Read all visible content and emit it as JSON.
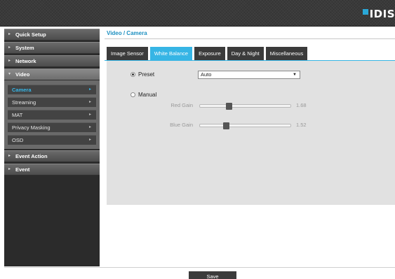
{
  "header": {
    "logo_text": "IDIS"
  },
  "sidebar": {
    "items": [
      {
        "label": "Quick Setup"
      },
      {
        "label": "System"
      },
      {
        "label": "Network"
      },
      {
        "label": "Video"
      },
      {
        "label": "Event Action"
      },
      {
        "label": "Event"
      }
    ],
    "video_submenu": [
      {
        "label": "Camera"
      },
      {
        "label": "Streaming"
      },
      {
        "label": "MAT"
      },
      {
        "label": "Privacy Masking"
      },
      {
        "label": "OSD"
      }
    ]
  },
  "main": {
    "breadcrumb": "Video / Camera",
    "tabs": [
      {
        "label": "Image Sensor"
      },
      {
        "label": "White Balance"
      },
      {
        "label": "Exposure"
      },
      {
        "label": "Day & Night"
      },
      {
        "label": "Miscellaneous"
      }
    ],
    "active_tab": "White Balance",
    "preset_label": "Preset",
    "preset_value": "Auto",
    "manual_label": "Manual",
    "mode_selected": "Preset",
    "red_gain": {
      "label": "Red Gain",
      "value": "1.68",
      "position": 0.33
    },
    "blue_gain": {
      "label": "Blue Gain",
      "value": "1.52",
      "position": 0.3
    }
  },
  "footer": {
    "save_label": "Save"
  },
  "colors": {
    "accent": "#36b5e5",
    "active_submenu_text": "#35b7e8",
    "breadcrumb": "#1c8fc0"
  }
}
